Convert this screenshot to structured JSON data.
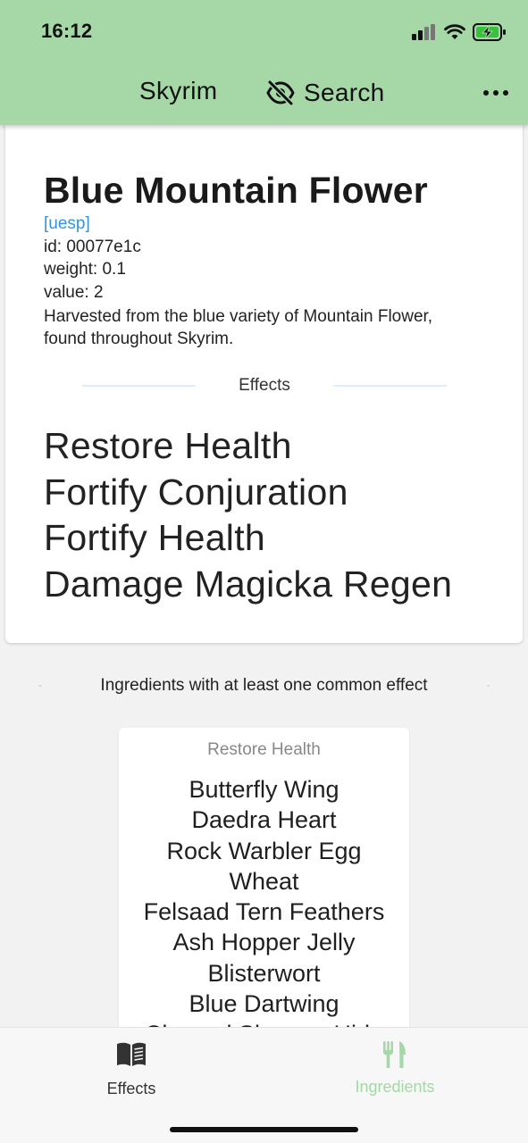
{
  "status_bar": {
    "time": "16:12"
  },
  "nav": {
    "title": "Skyrim",
    "search_label": "Search",
    "header_color": "#a5d7a7"
  },
  "ingredient": {
    "name": "Blue Mountain Flower",
    "link_text": "[uesp]",
    "id_line": "id: 00077e1c",
    "weight_line": "weight: 0.1",
    "value_line": "value: 2",
    "description": "Harvested from the blue variety of Mountain Flower, found throughout Skyrim.",
    "effects_label": "Effects",
    "effects": [
      "Restore Health",
      "Fortify Conjuration",
      "Fortify Health",
      "Damage Magicka Regen"
    ]
  },
  "common": {
    "header": "Ingredients with at least one common effect",
    "groups": [
      {
        "effect": "Restore Health",
        "ingredients": [
          "Butterfly Wing",
          "Daedra Heart",
          "Rock Warbler Egg",
          "Wheat",
          "Felsaad Tern Feathers",
          "Ash Hopper Jelly",
          "Blisterwort",
          "Blue Dartwing",
          "Charred Skeever Hide"
        ]
      }
    ]
  },
  "tabs": [
    {
      "label": "Effects",
      "icon": "book-icon",
      "active": false
    },
    {
      "label": "Ingredients",
      "icon": "fork-knife-icon",
      "active": true,
      "color": "#a5d7a7"
    }
  ]
}
